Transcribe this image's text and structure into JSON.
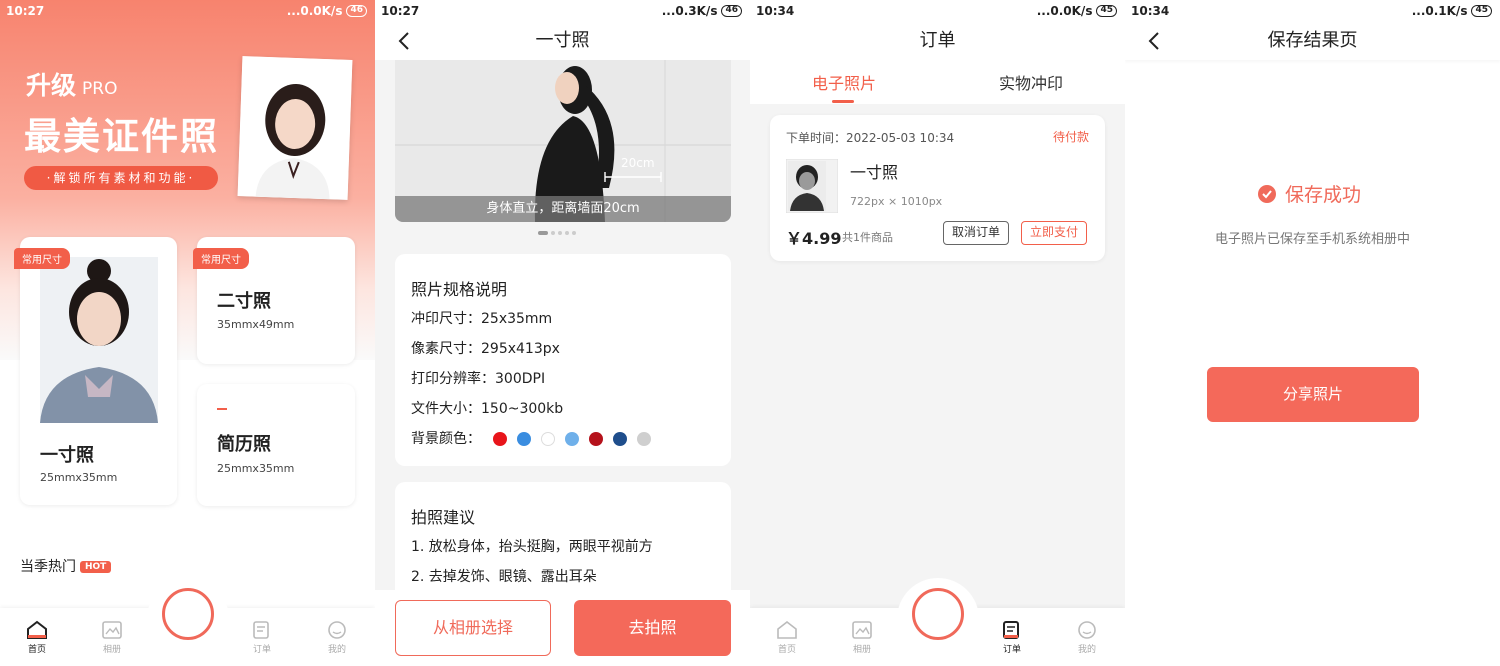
{
  "screen1": {
    "status": {
      "time": "10:27",
      "speed": "...0.0K/s",
      "battery": "46"
    },
    "hero": {
      "upgrade": "升级",
      "pro": "PRO",
      "headline": "最美证件照",
      "pill": "·解锁所有素材和功能·"
    },
    "cards": [
      {
        "tag": "常用尺寸",
        "name": "一寸照",
        "size": "25mmx35mm"
      },
      {
        "tag": "常用尺寸",
        "name": "二寸照",
        "size": "35mmx49mm"
      },
      {
        "tag": "",
        "name": "简历照",
        "size": "25mmx35mm"
      }
    ],
    "hot": {
      "label": "当季热门",
      "badge": "HOT"
    },
    "tabbar": [
      "首页",
      "相册",
      "订单",
      "我的"
    ]
  },
  "screen2": {
    "status": {
      "time": "10:27",
      "speed": "...0.3K/s",
      "battery": "46"
    },
    "title": "一寸照",
    "banner": {
      "caption": "身体直立，距离墙面20cm",
      "measure": "20cm"
    },
    "spec": {
      "heading": "照片规格说明",
      "rows": [
        {
          "label": "冲印尺寸：",
          "value": "25x35mm"
        },
        {
          "label": "像素尺寸：",
          "value": "295x413px"
        },
        {
          "label": "打印分辨率：",
          "value": "300DPI"
        },
        {
          "label": "文件大小：",
          "value": "150~300kb"
        }
      ],
      "bg_label": "背景颜色：",
      "bg_colors": [
        "#e8151b",
        "#3a8de0",
        "#ffffff",
        "#6fb0ea",
        "#b5121b",
        "#1f4e8c",
        "#cfcfcf"
      ]
    },
    "tips": {
      "heading": "拍照建议",
      "items": [
        "1. 放松身体，抬头挺胸，两眼平视前方",
        "2. 去掉发饰、眼镜、露出耳朵"
      ]
    },
    "buttons": {
      "album": "从相册选择",
      "shoot": "去拍照"
    }
  },
  "screen3": {
    "status": {
      "time": "10:34",
      "speed": "...0.0K/s",
      "battery": "45"
    },
    "title": "订单",
    "tabs": [
      "电子照片",
      "实物冲印"
    ],
    "order": {
      "time": "下单时间：2022-05-03 10:34",
      "status": "待付款",
      "name": "一寸照",
      "pixels": "722px × 1010px",
      "price": "￥4.99",
      "count": "共1件商品",
      "cancel": "取消订单",
      "pay": "立即支付"
    },
    "tabbar": [
      "首页",
      "相册",
      "订单",
      "我的"
    ]
  },
  "screen4": {
    "status": {
      "time": "10:34",
      "speed": "...0.1K/s",
      "battery": "45"
    },
    "title": "保存结果页",
    "success": "保存成功",
    "subtitle": "电子照片已保存至手机系统相册中",
    "share": "分享照片"
  },
  "colors": {
    "accent": "#f4695a",
    "accent_dark": "#f25f4a"
  }
}
